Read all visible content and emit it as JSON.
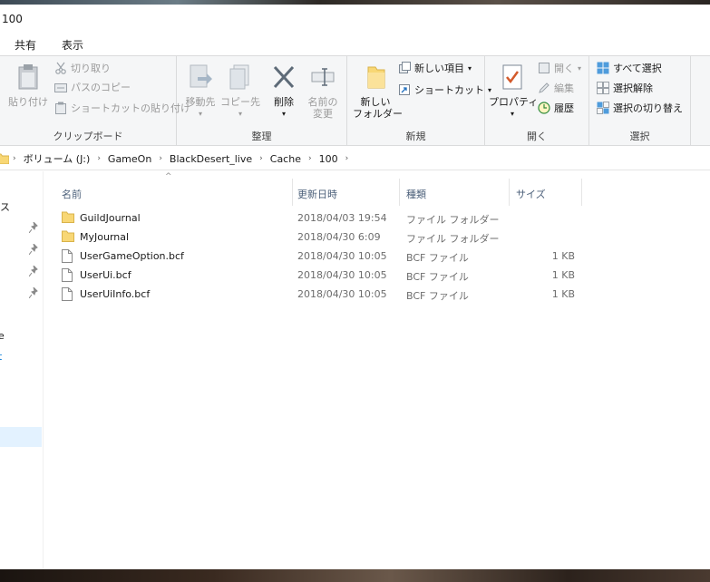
{
  "window": {
    "title": "100"
  },
  "tabs": [
    {
      "label": "共有"
    },
    {
      "label": "表示"
    }
  ],
  "ribbon": {
    "clipboard": {
      "label": "クリップボード",
      "paste": "貼り付け",
      "cut": "切り取り",
      "copy_path": "パスのコピー",
      "paste_shortcut": "ショートカットの貼り付け"
    },
    "organize": {
      "label": "整理",
      "move_to": "移動先",
      "copy_to": "コピー先",
      "delete": "削除",
      "rename_line1": "名前の",
      "rename_line2": "変更"
    },
    "new": {
      "label": "新規",
      "new_folder_line1": "新しい",
      "new_folder_line2": "フォルダー",
      "new_item": "新しい項目",
      "shortcut": "ショートカット"
    },
    "open": {
      "label": "開く",
      "properties": "プロパティ",
      "open": "開く",
      "edit": "編集",
      "history": "履歴"
    },
    "select": {
      "label": "選択",
      "select_all": "すべて選択",
      "select_none": "選択解除",
      "invert": "選択の切り替え"
    }
  },
  "breadcrumb": [
    "ボリューム (J:)",
    "GameOn",
    "BlackDesert_live",
    "Cache",
    "100"
  ],
  "nav_fragments": [
    "ス",
    "e",
    "t"
  ],
  "columns": {
    "name": "名前",
    "date": "更新日時",
    "type": "種類",
    "size": "サイズ"
  },
  "files": [
    {
      "name": "GuildJournal",
      "date": "2018/04/03 19:54",
      "type": "ファイル フォルダー",
      "size": "",
      "icon": "folder-icon"
    },
    {
      "name": "MyJournal",
      "date": "2018/04/30 6:09",
      "type": "ファイル フォルダー",
      "size": "",
      "icon": "folder-icon"
    },
    {
      "name": "UserGameOption.bcf",
      "date": "2018/04/30 10:05",
      "type": "BCF ファイル",
      "size": "1 KB",
      "icon": "file-icon"
    },
    {
      "name": "UserUi.bcf",
      "date": "2018/04/30 10:05",
      "type": "BCF ファイル",
      "size": "1 KB",
      "icon": "file-icon"
    },
    {
      "name": "UserUiInfo.bcf",
      "date": "2018/04/30 10:05",
      "type": "BCF ファイル",
      "size": "1 KB",
      "icon": "file-icon"
    }
  ],
  "colors": {
    "accent": "#0078d7",
    "folder": "#f8d775",
    "selection": "#cce8ff",
    "header_text": "#4c607a"
  }
}
